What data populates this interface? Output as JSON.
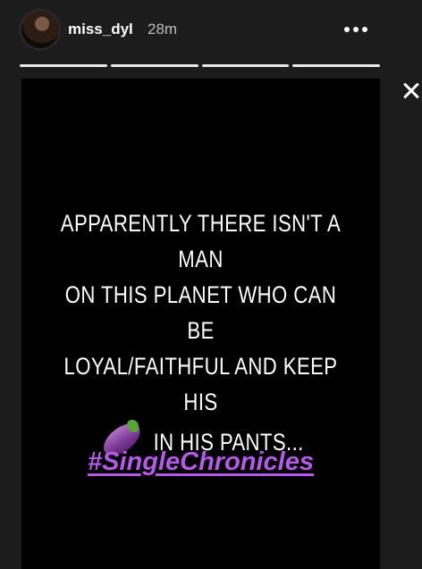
{
  "header": {
    "username": "miss_dyl",
    "timestamp": "28m"
  },
  "progress": {
    "segments": 4,
    "current_segment": 4
  },
  "story": {
    "lines": [
      "APPARENTLY THERE ISN'T A MAN",
      "ON THIS PLANET WHO CAN BE",
      "LOYAL/FAITHFUL AND KEEP HIS",
      "IN HIS PANTS..."
    ],
    "emoji": "eggplant-icon",
    "hashtag": "#SingleChronicles",
    "hashtag_color": "#b45ae6",
    "background_color": "#000000"
  }
}
